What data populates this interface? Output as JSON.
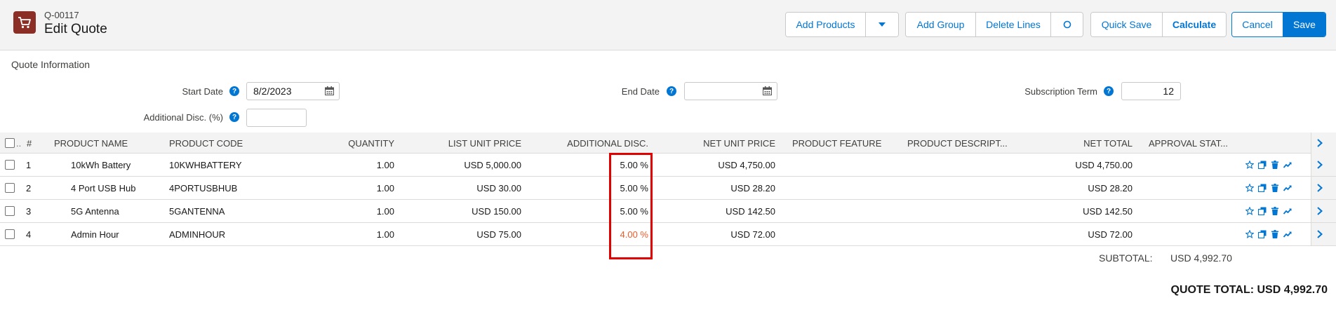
{
  "header": {
    "quote_number": "Q-00117",
    "title": "Edit Quote",
    "buttons": {
      "add_products": "Add Products",
      "add_group": "Add Group",
      "delete_lines": "Delete Lines",
      "quick_save": "Quick Save",
      "calculate": "Calculate",
      "cancel": "Cancel",
      "save": "Save"
    }
  },
  "quote_info": {
    "section_title": "Quote Information",
    "start_date_label": "Start Date",
    "start_date_value": "8/2/2023",
    "end_date_label": "End Date",
    "end_date_value": "",
    "subscription_term_label": "Subscription Term",
    "subscription_term_value": "12",
    "additional_disc_label": "Additional Disc. (%)",
    "additional_disc_value": ""
  },
  "table": {
    "columns": {
      "select": "..",
      "num": "#",
      "product_name": "PRODUCT NAME",
      "product_code": "PRODUCT CODE",
      "quantity": "QUANTITY",
      "list_unit_price": "LIST UNIT PRICE",
      "additional_disc": "ADDITIONAL DISC.",
      "net_unit_price": "NET UNIT PRICE",
      "product_feature": "PRODUCT FEATURE",
      "product_description": "PRODUCT DESCRIPT...",
      "net_total": "NET TOTAL",
      "approval_status": "APPROVAL STAT..."
    },
    "rows": [
      {
        "num": "1",
        "product_name": "10kWh Battery",
        "product_code": "10KWHBATTERY",
        "quantity": "1.00",
        "list_unit_price": "USD 5,000.00",
        "additional_disc": "5.00 %",
        "net_unit_price": "USD 4,750.00",
        "net_total": "USD 4,750.00"
      },
      {
        "num": "2",
        "product_name": "4 Port USB Hub",
        "product_code": "4PORTUSBHUB",
        "quantity": "1.00",
        "list_unit_price": "USD 30.00",
        "additional_disc": "5.00 %",
        "net_unit_price": "USD 28.20",
        "net_total": "USD 28.20"
      },
      {
        "num": "3",
        "product_name": "5G Antenna",
        "product_code": "5GANTENNA",
        "quantity": "1.00",
        "list_unit_price": "USD 150.00",
        "additional_disc": "5.00 %",
        "net_unit_price": "USD 142.50",
        "net_total": "USD 142.50"
      },
      {
        "num": "4",
        "product_name": "Admin Hour",
        "product_code": "ADMINHOUR",
        "quantity": "1.00",
        "list_unit_price": "USD 75.00",
        "additional_disc": "4.00 %",
        "net_unit_price": "USD 72.00",
        "net_total": "USD 72.00"
      }
    ]
  },
  "totals": {
    "subtotal_label": "SUBTOTAL:",
    "subtotal_value": "USD 4,992.70",
    "quote_total": "QUOTE TOTAL: USD 4,992.70"
  },
  "colors": {
    "brand_blue": "#0176d3",
    "app_icon": "#8b2e25",
    "highlight_box": "#e00000",
    "modified_value": "#f05a28"
  }
}
